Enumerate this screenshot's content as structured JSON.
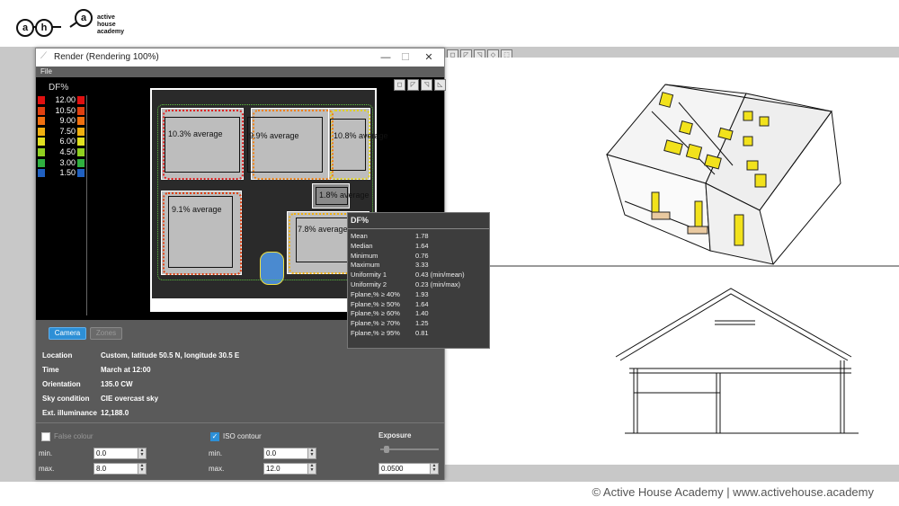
{
  "logo": {
    "letters": [
      "a",
      "h",
      "a"
    ],
    "name_line1": "active house",
    "name_line2": "academy"
  },
  "window": {
    "title": "Render (Rendering 100%)",
    "minimize": "—",
    "maximize": "☐",
    "close": "✕",
    "menu_file": "File"
  },
  "legend": {
    "title": "DF%",
    "items": [
      {
        "value": "12.00",
        "color": "#e01010"
      },
      {
        "value": "10.50",
        "color": "#e04010"
      },
      {
        "value": "9.00",
        "color": "#f07010"
      },
      {
        "value": "7.50",
        "color": "#f0b010"
      },
      {
        "value": "6.00",
        "color": "#e0e020"
      },
      {
        "value": "4.50",
        "color": "#90d020"
      },
      {
        "value": "3.00",
        "color": "#30b040"
      },
      {
        "value": "1.50",
        "color": "#2060c0"
      }
    ]
  },
  "zones": [
    {
      "label": "10.3% average"
    },
    {
      "label": "9.9% average"
    },
    {
      "label": "10.8% average"
    },
    {
      "label": "1.8% average"
    },
    {
      "label": "9.1% average"
    },
    {
      "label": "7.8% average"
    }
  ],
  "stats": {
    "title": "DF%",
    "rows": [
      {
        "k": "Mean",
        "v": "1.78"
      },
      {
        "k": "Median",
        "v": "1.64"
      },
      {
        "k": "Minimum",
        "v": "0.76"
      },
      {
        "k": "Maximum",
        "v": "3.33"
      },
      {
        "k": "Uniformity 1",
        "v": "0.43 (min/mean)"
      },
      {
        "k": "Uniformity 2",
        "v": "0.23 (min/max)"
      },
      {
        "k": "Fplane,% ≥ 40%",
        "v": "1.93"
      },
      {
        "k": "Fplane,% ≥ 50%",
        "v": "1.64"
      },
      {
        "k": "Fplane,% ≥ 60%",
        "v": "1.40"
      },
      {
        "k": "Fplane,% ≥ 70%",
        "v": "1.25"
      },
      {
        "k": "Fplane,% ≥ 95%",
        "v": "0.81"
      }
    ]
  },
  "tabs": {
    "camera": "Camera",
    "zones": "Zones"
  },
  "info": {
    "location_label": "Location",
    "location": "Custom, latitude 50.5 N, longitude 30.5 E",
    "time_label": "Time",
    "time": "March at 12:00",
    "orientation_label": "Orientation",
    "orientation": "135.0 CW",
    "sky_label": "Sky condition",
    "sky": "CIE overcast sky",
    "ext_label": "Ext. illuminance",
    "ext": "12,188.0"
  },
  "false_colour": {
    "label": "False colour",
    "checked": false,
    "min_label": "min.",
    "min": "0.0",
    "max_label": "max.",
    "max": "8.0"
  },
  "iso_contour": {
    "label": "ISO contour",
    "checked": true,
    "min_label": "min.",
    "min": "0.0",
    "max_label": "max.",
    "max": "12.0"
  },
  "exposure": {
    "label": "Exposure",
    "value": "0.0500",
    "level": 0.1
  },
  "footer": "© Active House Academy | www.activehouse.academy",
  "icons": [
    "app-icon",
    "toolbar-icon",
    "check-icon",
    "spin-arrow-icon"
  ]
}
